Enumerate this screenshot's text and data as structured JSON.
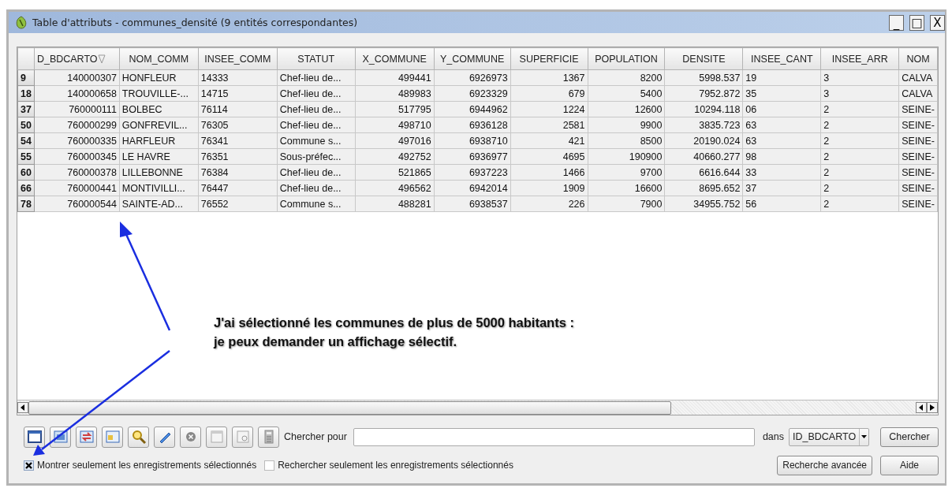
{
  "window": {
    "title": "Table d'attributs - communes_densité (9 entités correspondantes)",
    "controls": [
      "_",
      "□",
      "X"
    ]
  },
  "table": {
    "columns": [
      {
        "label": "D_BDCARTO",
        "kind": "number",
        "sorted": true
      },
      {
        "label": "NOM_COMM",
        "kind": "text",
        "sorted": false
      },
      {
        "label": "INSEE_COMM",
        "kind": "text",
        "sorted": false
      },
      {
        "label": "STATUT",
        "kind": "text",
        "sorted": false
      },
      {
        "label": "X_COMMUNE",
        "kind": "number",
        "sorted": false
      },
      {
        "label": "Y_COMMUNE",
        "kind": "number",
        "sorted": false
      },
      {
        "label": "SUPERFICIE",
        "kind": "number",
        "sorted": false
      },
      {
        "label": "POPULATION",
        "kind": "number",
        "sorted": false
      },
      {
        "label": "DENSITE",
        "kind": "number",
        "sorted": false
      },
      {
        "label": "INSEE_CANT",
        "kind": "text",
        "sorted": false
      },
      {
        "label": "INSEE_ARR",
        "kind": "text",
        "sorted": false
      },
      {
        "label": "NOM",
        "kind": "text",
        "sorted": false
      }
    ],
    "rows": [
      {
        "header": "9",
        "cells": [
          "140000307",
          "HONFLEUR",
          "14333",
          "Chef-lieu de...",
          "499441",
          "6926973",
          "1367",
          "8200",
          "5998.537",
          "19",
          "3",
          "CALVA"
        ]
      },
      {
        "header": "18",
        "cells": [
          "140000658",
          "TROUVILLE-...",
          "14715",
          "Chef-lieu de...",
          "489983",
          "6923329",
          "679",
          "5400",
          "7952.872",
          "35",
          "3",
          "CALVA"
        ]
      },
      {
        "header": "37",
        "cells": [
          "760000111",
          "BOLBEC",
          "76114",
          "Chef-lieu de...",
          "517795",
          "6944962",
          "1224",
          "12600",
          "10294.118",
          "06",
          "2",
          "SEINE-"
        ]
      },
      {
        "header": "50",
        "cells": [
          "760000299",
          "GONFREVIL...",
          "76305",
          "Chef-lieu de...",
          "498710",
          "6936128",
          "2581",
          "9900",
          "3835.723",
          "63",
          "2",
          "SEINE-"
        ]
      },
      {
        "header": "54",
        "cells": [
          "760000335",
          "HARFLEUR",
          "76341",
          "Commune s...",
          "497016",
          "6938710",
          "421",
          "8500",
          "20190.024",
          "63",
          "2",
          "SEINE-"
        ]
      },
      {
        "header": "55",
        "cells": [
          "760000345",
          "LE HAVRE",
          "76351",
          "Sous-préfec...",
          "492752",
          "6936977",
          "4695",
          "190900",
          "40660.277",
          "98",
          "2",
          "SEINE-"
        ]
      },
      {
        "header": "60",
        "cells": [
          "760000378",
          "LILLEBONNE",
          "76384",
          "Chef-lieu de...",
          "521865",
          "6937223",
          "1466",
          "9700",
          "6616.644",
          "33",
          "2",
          "SEINE-"
        ]
      },
      {
        "header": "66",
        "cells": [
          "760000441",
          "MONTIVILLI...",
          "76447",
          "Chef-lieu de...",
          "496562",
          "6942014",
          "1909",
          "16600",
          "8695.652",
          "37",
          "2",
          "SEINE-"
        ]
      },
      {
        "header": "78",
        "cells": [
          "760000544",
          "SAINTE-AD...",
          "76552",
          "Commune s...",
          "488281",
          "6938537",
          "226",
          "7900",
          "34955.752",
          "56",
          "2",
          "SEINE-"
        ]
      }
    ]
  },
  "search": {
    "label": "Chercher pour",
    "in_label": "dans",
    "field": "ID_BDCARTO",
    "button": "Chercher"
  },
  "options": [
    {
      "label": "Montrer seulement les enregistrements sélectionnés",
      "checked": true
    },
    {
      "label": "Rechercher seulement les enregistrements sélectionnés",
      "checked": false
    }
  ],
  "buttons": [
    "Recherche avancée",
    "Aide"
  ],
  "annotation": {
    "lines": [
      "J'ai sélectionné les communes de plus de 5000 habitants :",
      "je peux demander un affichage sélectif."
    ]
  }
}
